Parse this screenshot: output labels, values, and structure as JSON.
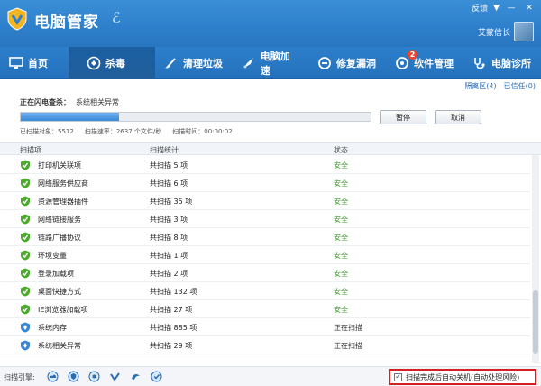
{
  "app": {
    "title": "电脑管家",
    "top_links": [
      "反馈",
      "▼"
    ],
    "window_buttons": [
      "—",
      "✕"
    ],
    "user_name": "艾蒙信长"
  },
  "nav": {
    "items": [
      {
        "label": "首页",
        "icon": "monitor-icon"
      },
      {
        "label": "杀毒",
        "icon": "shield-icon",
        "active": true
      },
      {
        "label": "清理垃圾",
        "icon": "broom-icon"
      },
      {
        "label": "电脑加速",
        "icon": "rocket-icon"
      },
      {
        "label": "修复漏洞",
        "icon": "patch-icon"
      },
      {
        "label": "软件管理",
        "icon": "apps-icon",
        "badge": "2"
      },
      {
        "label": "电脑诊所",
        "icon": "stethoscope-icon"
      }
    ]
  },
  "quick_links": [
    "隔离区(4)",
    "已信任(0)"
  ],
  "scan": {
    "status_label": "正在闪电查杀：",
    "status_target": "系统相关异常",
    "progress_percent": 28,
    "pause_label": "暂停",
    "cancel_label": "取消",
    "scanned_objects": "已扫描对象：5512",
    "scan_speed": "扫描速率：2637 个文件/秒",
    "scan_time": "扫描时间：00:00:02"
  },
  "table": {
    "headers": [
      "扫描项",
      "扫描统计",
      "状态"
    ],
    "rows": [
      {
        "name": "打印机关联项",
        "count": "共扫描 5 项",
        "status": "安全",
        "state": "safe"
      },
      {
        "name": "网络服务供应商",
        "count": "共扫描 6 项",
        "status": "安全",
        "state": "safe"
      },
      {
        "name": "资源管理器插件",
        "count": "共扫描 35 项",
        "status": "安全",
        "state": "safe"
      },
      {
        "name": "网络链接服务",
        "count": "共扫描 3 项",
        "status": "安全",
        "state": "safe"
      },
      {
        "name": "链路广播协议",
        "count": "共扫描 8 项",
        "status": "安全",
        "state": "safe"
      },
      {
        "name": "环境变量",
        "count": "共扫描 1 项",
        "status": "安全",
        "state": "safe"
      },
      {
        "name": "登录加载项",
        "count": "共扫描 2 项",
        "status": "安全",
        "state": "safe"
      },
      {
        "name": "桌面快捷方式",
        "count": "共扫描 132 项",
        "status": "安全",
        "state": "safe"
      },
      {
        "name": "IE浏览器加载项",
        "count": "共扫描 27 项",
        "status": "安全",
        "state": "safe"
      },
      {
        "name": "系统内存",
        "count": "共扫描 885 项",
        "status": "正在扫描",
        "state": "scanning"
      },
      {
        "name": "系统相关异常",
        "count": "共扫描 29 项",
        "status": "正在扫描",
        "state": "scanning"
      }
    ]
  },
  "bottom": {
    "engine_label": "扫描引擎:",
    "engines": [
      "cloud-engine-icon",
      "shield-engine-icon",
      "local-engine-icon",
      "repair-engine-icon",
      "bd-engine-icon",
      "av-engine-icon"
    ],
    "auto_shutdown_label": "扫描完成后自动关机(自动处理风险)",
    "auto_shutdown_checked": true
  },
  "colors": {
    "title_blue": "#2d7fcb",
    "safe_green": "#3a9a2a",
    "highlight_red": "#d42020"
  }
}
